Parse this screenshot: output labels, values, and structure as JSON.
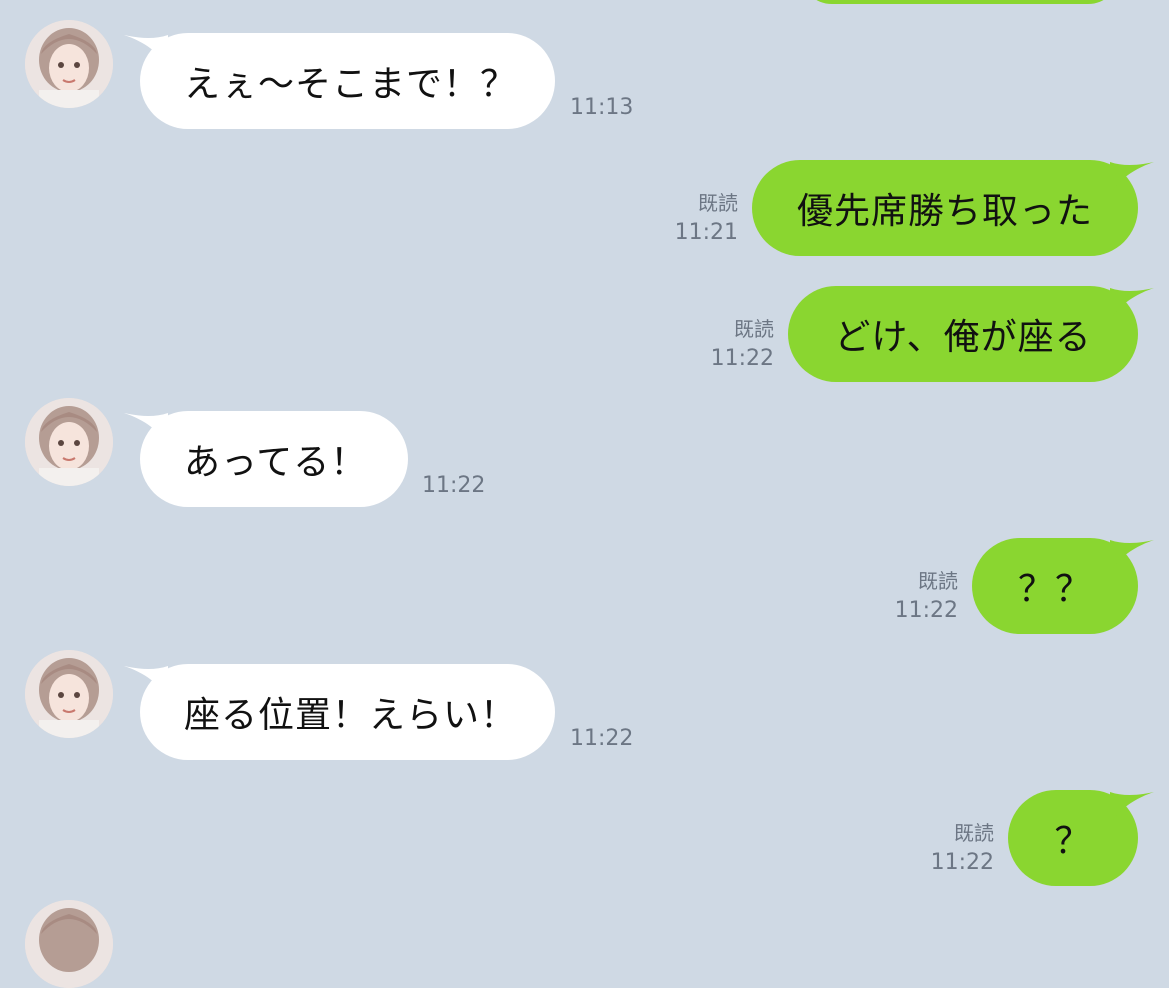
{
  "theme": {
    "background": "#cfd9e4",
    "incoming_bubble": "#ffffff",
    "outgoing_bubble": "#8ad630",
    "meta_text": "#6c7684"
  },
  "contact": {
    "avatar_icon": "user-avatar-photo"
  },
  "messages": [
    {
      "direction": "in",
      "text": "えぇ〜そこまで！？",
      "time": "11:13"
    },
    {
      "direction": "out",
      "text": "優先席勝ち取った",
      "read": "既読",
      "time": "11:21"
    },
    {
      "direction": "out",
      "text": "どけ、俺が座る",
      "read": "既読",
      "time": "11:22"
    },
    {
      "direction": "in",
      "text": "あってる！",
      "time": "11:22"
    },
    {
      "direction": "out",
      "text": "？？",
      "read": "既読",
      "time": "11:22"
    },
    {
      "direction": "in",
      "text": "座る位置！えらい！",
      "time": "11:22"
    },
    {
      "direction": "out",
      "text": "？",
      "read": "既読",
      "time": "11:22"
    }
  ]
}
